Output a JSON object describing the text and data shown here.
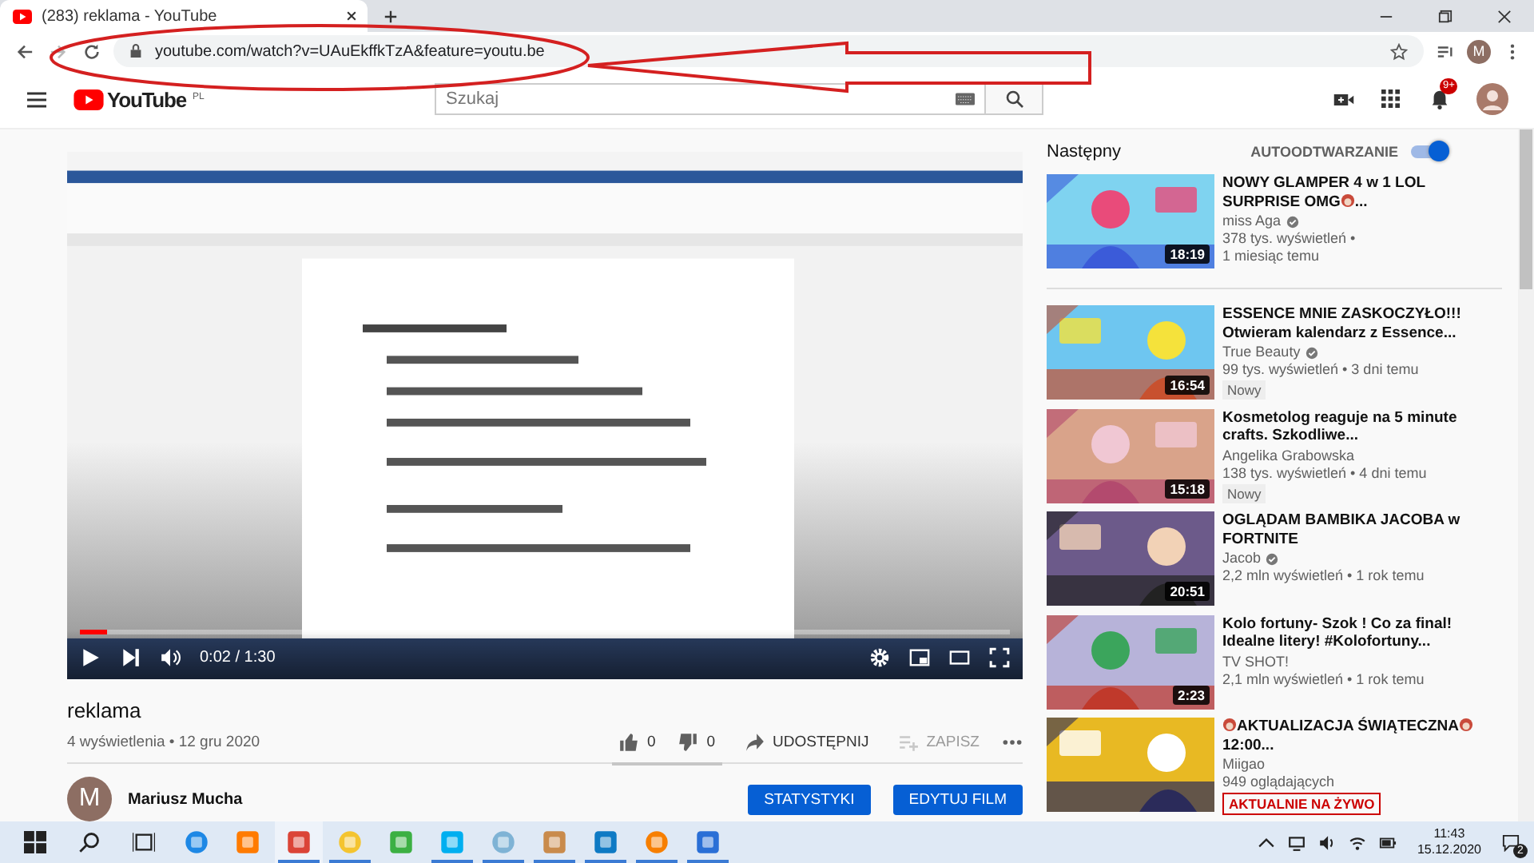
{
  "browser": {
    "tab": {
      "title": "(283) reklama - YouTube"
    },
    "url": "youtube.com/watch?v=UAuEkffkTzA&feature=youtu.be",
    "profile": "M"
  },
  "header": {
    "logo": "YouTube",
    "region": "PL",
    "search": {
      "placeholder": "Szukaj"
    },
    "notifications": "9+"
  },
  "player": {
    "kind": "picture",
    "time": "0:02 / 1:30",
    "progress": {
      "level": 0.03
    }
  },
  "video": {
    "title": "reklama",
    "meta": "4 wyświetlenia • 12 gru 2020",
    "likes": "0",
    "dislikes": "0",
    "share": "UDOSTĘPNIJ",
    "save": {
      "label": "ZAPISZ",
      "disabled": true
    }
  },
  "channel": {
    "avatar": "M",
    "name": "Mariusz Mucha",
    "buttons": [
      "STATYSTYKI",
      "EDYTUJ FILM"
    ]
  },
  "sidebar": {
    "heading": "Następny",
    "autoplay": {
      "label": "AUTOODTWARZANIE",
      "on": true
    },
    "items": [
      {
        "title": [
          {
            "kind": "text",
            "text": "NOWY GLAMPER 4 w 1 LOL SURPRISE OMG"
          },
          {
            "kind": "icon"
          },
          {
            "kind": "text",
            "text": "..."
          }
        ],
        "channel": "miss Aga",
        "verified": true,
        "meta": [
          "378 tys. wyświetleń •",
          "1 miesiąc temu"
        ],
        "duration": "18:19"
      },
      {
        "title": [
          {
            "kind": "text",
            "text": "ESSENCE MNIE ZASKOCZYŁO!!! Otwieram kalendarz z Essence..."
          }
        ],
        "channel": "True Beauty",
        "verified": true,
        "meta": [
          "99 tys. wyświetleń • 3 dni temu"
        ],
        "duration": "16:54",
        "badge": {
          "kind": "new",
          "text": "Nowy"
        }
      },
      {
        "title": [
          {
            "kind": "text",
            "text": "Kosmetolog reaguje na 5 minute crafts. Szkodliwe..."
          }
        ],
        "channel": "Angelika Grabowska",
        "verified": false,
        "meta": [
          "138 tys. wyświetleń • 4 dni temu"
        ],
        "duration": "15:18",
        "badge": {
          "kind": "new",
          "text": "Nowy"
        }
      },
      {
        "title": [
          {
            "kind": "text",
            "text": "OGLĄDAM BAMBIKA JACOBA w FORTNITE"
          }
        ],
        "channel": "Jacob",
        "verified": true,
        "meta": [
          "2,2 mln wyświetleń • 1 rok temu"
        ],
        "duration": "20:51"
      },
      {
        "title": [
          {
            "kind": "text",
            "text": "Kolo fortuny- Szok ! Co za final! Idealne litery! #Kolofortuny..."
          }
        ],
        "channel": "TV SHOT!",
        "verified": false,
        "meta": [
          "2,1 mln wyświetleń • 1 rok temu"
        ],
        "duration": "2:23"
      },
      {
        "title": [
          {
            "kind": "icon"
          },
          {
            "kind": "text",
            "text": "AKTUALIZACJA ŚWIĄTECZNA"
          },
          {
            "kind": "icon"
          },
          {
            "kind": "text",
            "text": "12:00..."
          }
        ],
        "channel": "Miigao",
        "verified": false,
        "meta": [
          "949 oglądających"
        ],
        "badge": {
          "kind": "live",
          "text": "AKTUALNIE NA ŻYWO"
        }
      }
    ]
  },
  "taskbar": {
    "apps": [
      {
        "color": "#1e88e5",
        "active": false,
        "running": false
      },
      {
        "color": "#ff7b00",
        "active": false,
        "running": false
      },
      {
        "color": "#db4437",
        "active": true,
        "running": true
      },
      {
        "color": "#f4c430",
        "active": false,
        "running": true
      },
      {
        "color": "#3cb043",
        "active": false,
        "running": false
      },
      {
        "color": "#00aff0",
        "active": false,
        "running": true
      },
      {
        "color": "#7fb3d5",
        "active": false,
        "running": true
      },
      {
        "color": "#c98b4c",
        "active": false,
        "running": true
      },
      {
        "color": "#0e7ac4",
        "active": false,
        "running": true
      },
      {
        "color": "#f77f00",
        "active": false,
        "running": true
      },
      {
        "color": "#2a6fd6",
        "active": false,
        "running": true
      }
    ],
    "time": "11:43",
    "date": "15.12.2020",
    "notifications": "2"
  }
}
